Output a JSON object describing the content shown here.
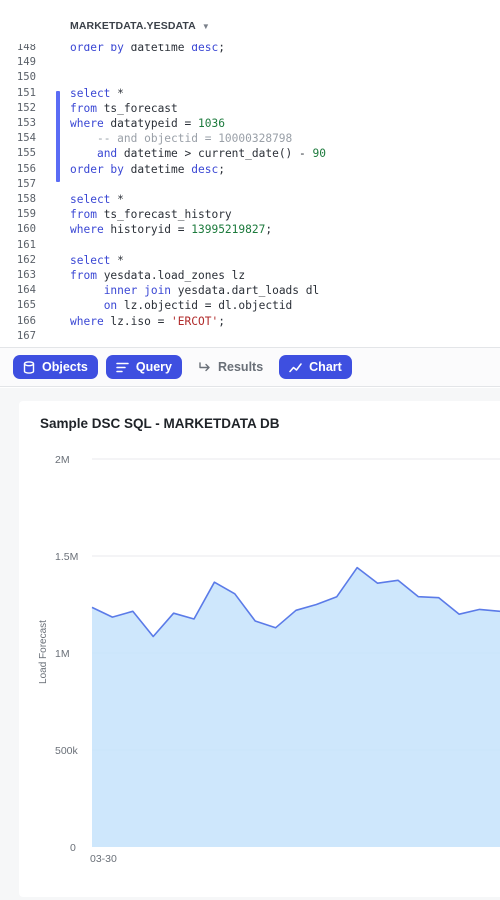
{
  "db_selector": {
    "label": "MARKETDATA.YESDATA",
    "icon": "chevron-down-icon"
  },
  "editor": {
    "lines": [
      {
        "n": "148",
        "tokens": [
          [
            "kw",
            "order by "
          ],
          [
            "",
            "datetime "
          ],
          [
            "kw",
            "desc"
          ],
          [
            "",
            ";"
          ]
        ]
      },
      {
        "n": "149",
        "tokens": []
      },
      {
        "n": "150",
        "tokens": []
      },
      {
        "n": "151",
        "tokens": [
          [
            "kw",
            "select"
          ],
          [
            "",
            " *"
          ]
        ]
      },
      {
        "n": "152",
        "tokens": [
          [
            "kw",
            "from"
          ],
          [
            "",
            " ts_forecast"
          ]
        ]
      },
      {
        "n": "153",
        "tokens": [
          [
            "kw",
            "where"
          ],
          [
            "",
            " datatypeid = "
          ],
          [
            "num",
            "1036"
          ]
        ]
      },
      {
        "n": "154",
        "tokens": [
          [
            "",
            "    "
          ],
          [
            "cmt",
            "-- and objectid = 10000328798"
          ]
        ]
      },
      {
        "n": "155",
        "tokens": [
          [
            "",
            "    "
          ],
          [
            "kw",
            "and"
          ],
          [
            "",
            " datetime > current_date() - "
          ],
          [
            "num",
            "90"
          ]
        ]
      },
      {
        "n": "156",
        "tokens": [
          [
            "kw",
            "order by"
          ],
          [
            "",
            " datetime "
          ],
          [
            "kw",
            "desc"
          ],
          [
            "",
            ";"
          ]
        ]
      },
      {
        "n": "157",
        "tokens": []
      },
      {
        "n": "158",
        "tokens": [
          [
            "kw",
            "select"
          ],
          [
            "",
            " *"
          ]
        ]
      },
      {
        "n": "159",
        "tokens": [
          [
            "kw",
            "from"
          ],
          [
            "",
            " ts_forecast_history"
          ]
        ]
      },
      {
        "n": "160",
        "tokens": [
          [
            "kw",
            "where"
          ],
          [
            "",
            " historyid = "
          ],
          [
            "num",
            "13995219827"
          ],
          [
            "",
            ";"
          ]
        ]
      },
      {
        "n": "161",
        "tokens": []
      },
      {
        "n": "162",
        "tokens": [
          [
            "kw",
            "select"
          ],
          [
            "",
            " *"
          ]
        ]
      },
      {
        "n": "163",
        "tokens": [
          [
            "kw",
            "from"
          ],
          [
            "",
            " yesdata.load_zones lz"
          ]
        ]
      },
      {
        "n": "164",
        "tokens": [
          [
            "",
            "     "
          ],
          [
            "kw",
            "inner join"
          ],
          [
            "",
            " yesdata.dart_loads dl"
          ]
        ]
      },
      {
        "n": "165",
        "tokens": [
          [
            "",
            "     "
          ],
          [
            "kw",
            "on"
          ],
          [
            "",
            " lz.objectid = dl.objectid"
          ]
        ]
      },
      {
        "n": "166",
        "tokens": [
          [
            "kw",
            "where"
          ],
          [
            "",
            " lz.iso = "
          ],
          [
            "str",
            "'ERCOT'"
          ],
          [
            "",
            ";"
          ]
        ]
      },
      {
        "n": "167",
        "tokens": []
      }
    ]
  },
  "toolbar": {
    "objects_label": "Objects",
    "query_label": "Query",
    "results_label": "Results",
    "chart_label": "Chart"
  },
  "colors": {
    "accent": "#3e4fe0",
    "gutter": "#5b6cf5",
    "line": "#5b7be8",
    "area": "#c6e3fb"
  },
  "chart_data": {
    "type": "area",
    "title": "Sample DSC SQL - MARKETDATA DB",
    "ylabel": "Load Forecast",
    "xlabel": "",
    "ylim": [
      0,
      2000000
    ],
    "yticks": [
      "2M",
      "1.5M",
      "1M",
      "500k",
      "0"
    ],
    "ytick_values": [
      2000000,
      1500000,
      1000000,
      500000,
      0
    ],
    "x_first_label": "03-30",
    "grid": true,
    "values": [
      1235000,
      1185000,
      1215000,
      1085000,
      1205000,
      1175000,
      1365000,
      1305000,
      1165000,
      1130000,
      1220000,
      1250000,
      1290000,
      1440000,
      1360000,
      1375000,
      1290000,
      1285000,
      1200000,
      1225000,
      1215000
    ]
  }
}
